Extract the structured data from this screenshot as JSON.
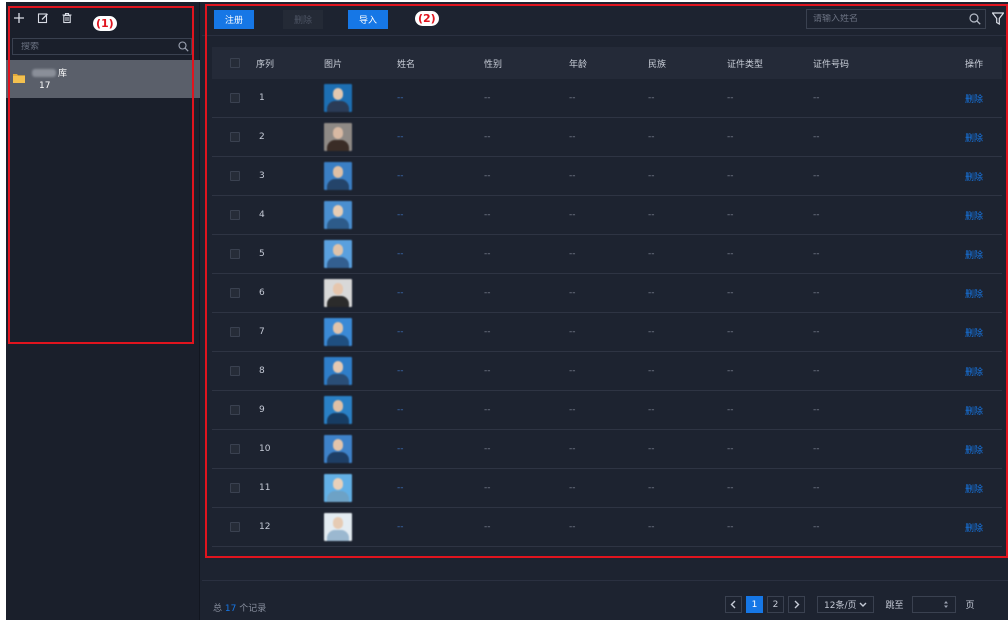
{
  "sidebar": {
    "toolbar": {
      "add_icon": "plus-icon",
      "edit_icon": "edit-icon",
      "delete_icon": "trash-icon"
    },
    "search": {
      "placeholder": "搜索"
    },
    "library": {
      "name_suffix": "库",
      "count": "17"
    }
  },
  "toolbar": {
    "register_label": "注册",
    "delete_label": "删除",
    "import_label": "导入",
    "search_placeholder": "请输入姓名"
  },
  "table": {
    "headers": {
      "index": "序列",
      "photo": "图片",
      "name": "姓名",
      "gender": "性别",
      "age": "年龄",
      "ethnicity": "民族",
      "id_type": "证件类型",
      "id_number": "证件号码",
      "action": "操作"
    },
    "rows": [
      {
        "index": "1",
        "name": "--",
        "gender": "--",
        "age": "--",
        "ethnicity": "--",
        "id_type": "--",
        "id_number": "--",
        "action": "删除"
      },
      {
        "index": "2",
        "name": "--",
        "gender": "--",
        "age": "--",
        "ethnicity": "--",
        "id_type": "--",
        "id_number": "--",
        "action": "删除"
      },
      {
        "index": "3",
        "name": "--",
        "gender": "--",
        "age": "--",
        "ethnicity": "--",
        "id_type": "--",
        "id_number": "--",
        "action": "删除"
      },
      {
        "index": "4",
        "name": "--",
        "gender": "--",
        "age": "--",
        "ethnicity": "--",
        "id_type": "--",
        "id_number": "--",
        "action": "删除"
      },
      {
        "index": "5",
        "name": "--",
        "gender": "--",
        "age": "--",
        "ethnicity": "--",
        "id_type": "--",
        "id_number": "--",
        "action": "删除"
      },
      {
        "index": "6",
        "name": "--",
        "gender": "--",
        "age": "--",
        "ethnicity": "--",
        "id_type": "--",
        "id_number": "--",
        "action": "删除"
      },
      {
        "index": "7",
        "name": "--",
        "gender": "--",
        "age": "--",
        "ethnicity": "--",
        "id_type": "--",
        "id_number": "--",
        "action": "删除"
      },
      {
        "index": "8",
        "name": "--",
        "gender": "--",
        "age": "--",
        "ethnicity": "--",
        "id_type": "--",
        "id_number": "--",
        "action": "删除"
      },
      {
        "index": "9",
        "name": "--",
        "gender": "--",
        "age": "--",
        "ethnicity": "--",
        "id_type": "--",
        "id_number": "--",
        "action": "删除"
      },
      {
        "index": "10",
        "name": "--",
        "gender": "--",
        "age": "--",
        "ethnicity": "--",
        "id_type": "--",
        "id_number": "--",
        "action": "删除"
      },
      {
        "index": "11",
        "name": "--",
        "gender": "--",
        "age": "--",
        "ethnicity": "--",
        "id_type": "--",
        "id_number": "--",
        "action": "删除"
      },
      {
        "index": "12",
        "name": "--",
        "gender": "--",
        "age": "--",
        "ethnicity": "--",
        "id_type": "--",
        "id_number": "--",
        "action": "删除"
      }
    ]
  },
  "footer": {
    "total_prefix": "总",
    "total_count": "17",
    "total_suffix": "个记录",
    "pages": [
      "1",
      "2"
    ],
    "current_page": "1",
    "page_size": "12条/页",
    "jump_label": "跳至",
    "page_label": "页"
  },
  "annotations": {
    "left": "(1)",
    "right": "(2)"
  },
  "colors": {
    "accent": "#1677e6",
    "annotation": "#e0141e",
    "background": "#1d2330"
  }
}
